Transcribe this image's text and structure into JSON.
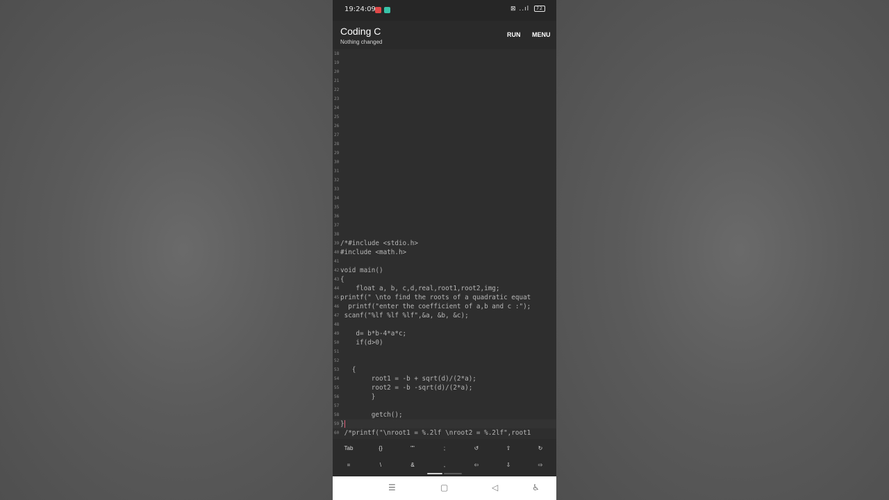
{
  "status_bar": {
    "time": "19:24:09",
    "battery": "72",
    "icons": "⊠ ..ıl"
  },
  "app_bar": {
    "title": "Coding C",
    "subtitle": "Nothing changed",
    "run_label": "RUN",
    "menu_label": "MENU"
  },
  "editor": {
    "lines": [
      {
        "num": "18",
        "code": ""
      },
      {
        "num": "19",
        "code": ""
      },
      {
        "num": "20",
        "code": ""
      },
      {
        "num": "21",
        "code": ""
      },
      {
        "num": "22",
        "code": ""
      },
      {
        "num": "23",
        "code": ""
      },
      {
        "num": "24",
        "code": ""
      },
      {
        "num": "25",
        "code": ""
      },
      {
        "num": "26",
        "code": ""
      },
      {
        "num": "27",
        "code": ""
      },
      {
        "num": "28",
        "code": ""
      },
      {
        "num": "29",
        "code": ""
      },
      {
        "num": "30",
        "code": ""
      },
      {
        "num": "31",
        "code": ""
      },
      {
        "num": "32",
        "code": ""
      },
      {
        "num": "33",
        "code": ""
      },
      {
        "num": "34",
        "code": ""
      },
      {
        "num": "35",
        "code": ""
      },
      {
        "num": "36",
        "code": ""
      },
      {
        "num": "37",
        "code": ""
      },
      {
        "num": "38",
        "code": ""
      },
      {
        "num": "39",
        "code": "/*#include <stdio.h>"
      },
      {
        "num": "40",
        "code": "#include <math.h>"
      },
      {
        "num": "41",
        "code": ""
      },
      {
        "num": "42",
        "code": "void main()"
      },
      {
        "num": "43",
        "code": "{"
      },
      {
        "num": "44",
        "code": "    float a, b, c,d,real,root1,root2,img;"
      },
      {
        "num": "45",
        "code": "printf(\" \\nto find the roots of a quadratic equat"
      },
      {
        "num": "46",
        "code": "  printf(\"enter the coefficient of a,b and c :\");"
      },
      {
        "num": "47",
        "code": " scanf(\"%lf %lf %lf\",&a, &b, &c);"
      },
      {
        "num": "48",
        "code": ""
      },
      {
        "num": "49",
        "code": "    d= b*b-4*a*c;"
      },
      {
        "num": "50",
        "code": "    if(d>0)"
      },
      {
        "num": "51",
        "code": ""
      },
      {
        "num": "52",
        "code": ""
      },
      {
        "num": "53",
        "code": "   {"
      },
      {
        "num": "54",
        "code": "        root1 = -b + sqrt(d)/(2*a);"
      },
      {
        "num": "55",
        "code": "        root2 = -b -sqrt(d)/(2*a);"
      },
      {
        "num": "56",
        "code": "        }"
      },
      {
        "num": "57",
        "code": ""
      },
      {
        "num": "58",
        "code": "        getch();"
      },
      {
        "num": "59",
        "code": "}"
      },
      {
        "num": "60",
        "code": " /*printf(\"\\nroot1 = %.2lf \\nroot2 = %.2lf\",root1"
      }
    ],
    "current_line": "59"
  },
  "keyboard": {
    "row1": [
      "Tab",
      "{}",
      "\"\"",
      ";",
      "↺",
      "⇧",
      "↻"
    ],
    "row2": [
      "=",
      "\\",
      "&",
      ",",
      "⇦",
      "⇩",
      "⇨"
    ]
  },
  "nav": {
    "menu_icon": "☰",
    "home_icon": "▢",
    "back_icon": "◁",
    "accessibility_icon": "♿"
  }
}
